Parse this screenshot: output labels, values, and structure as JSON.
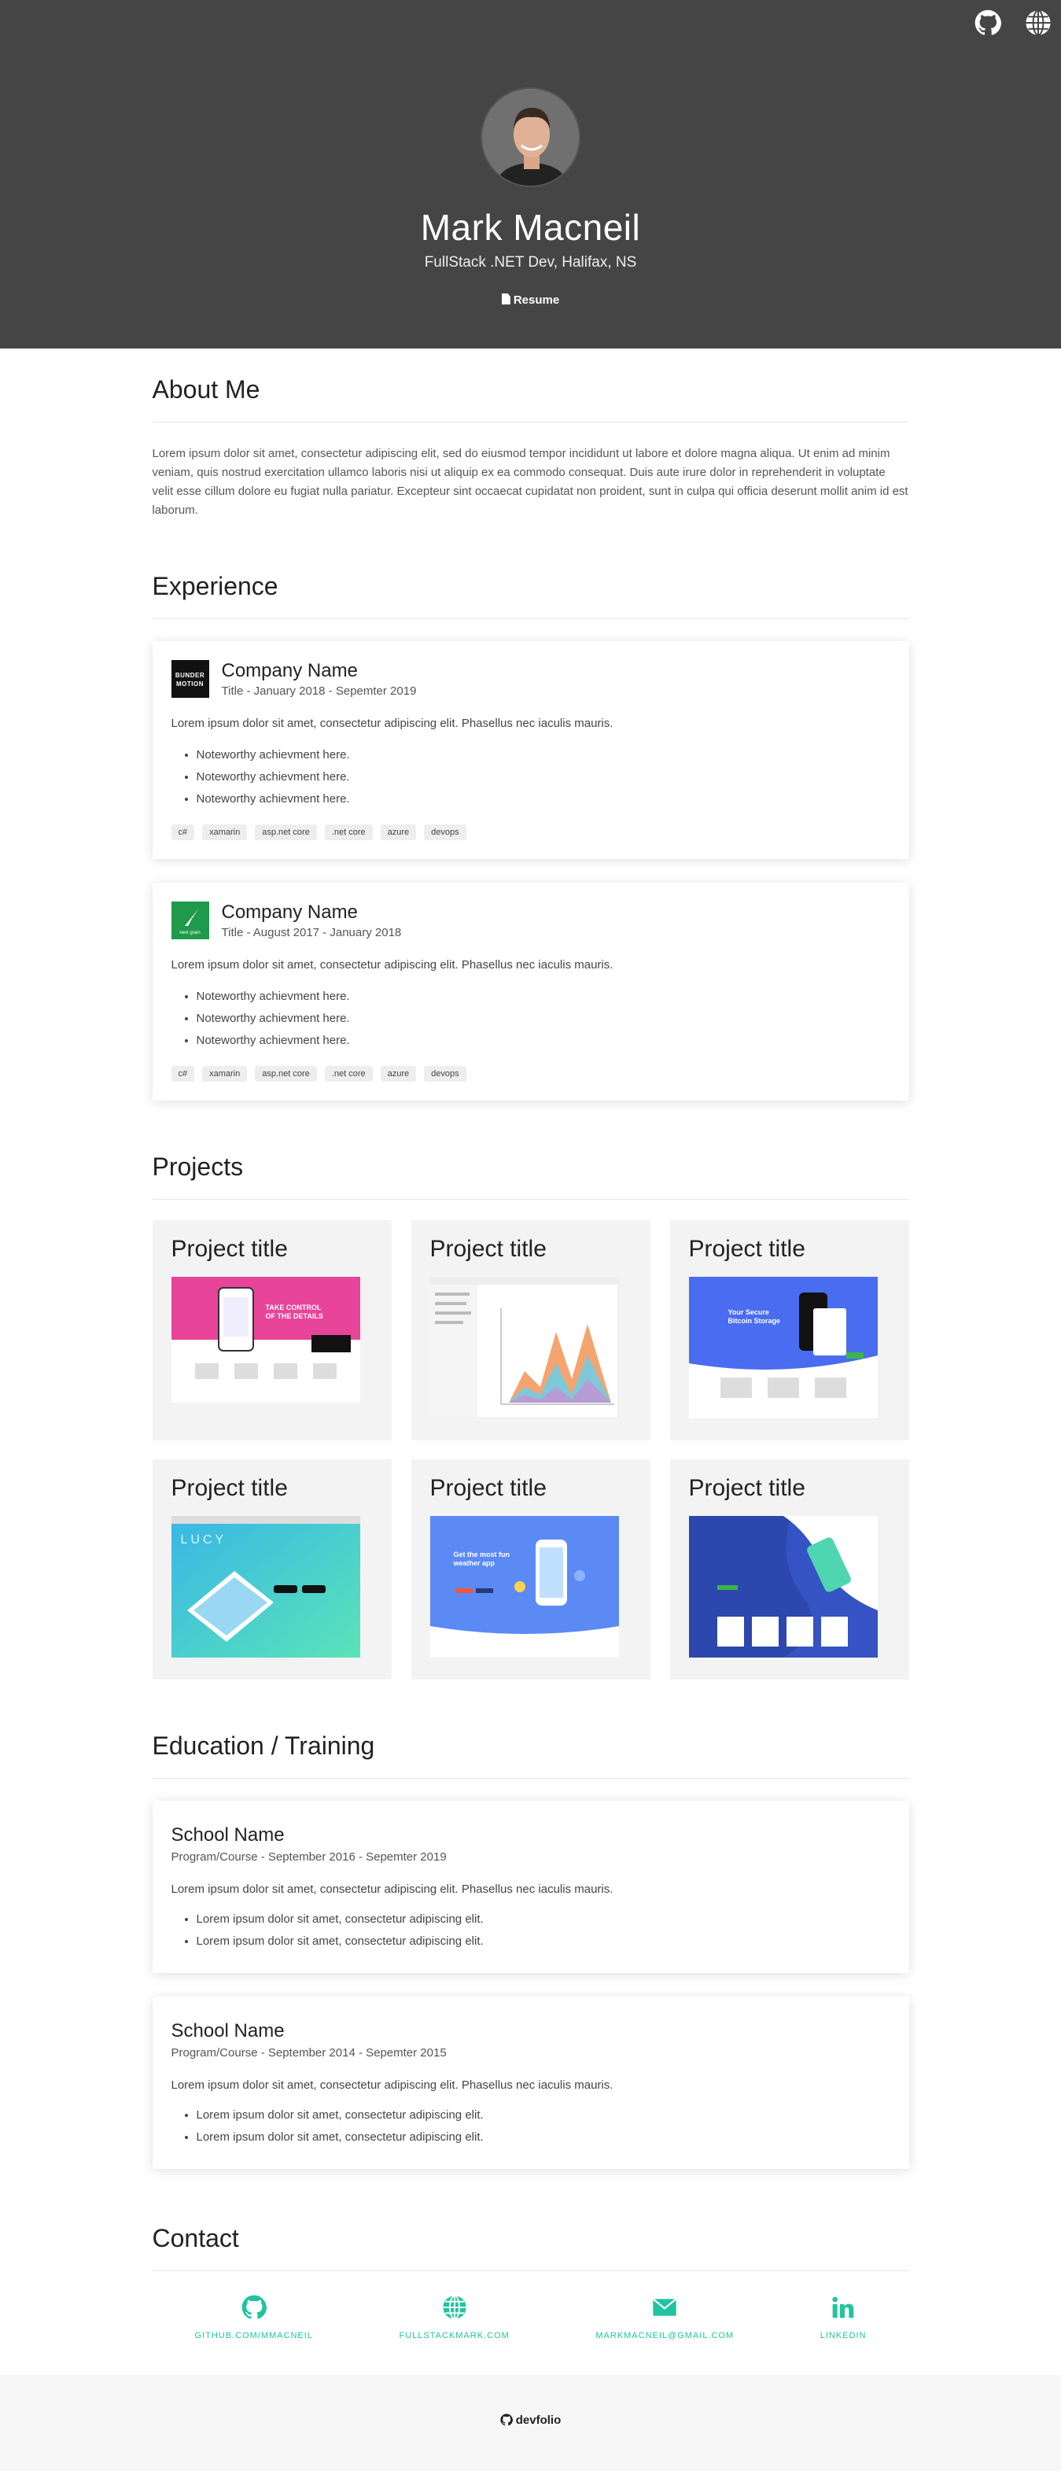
{
  "header": {
    "name": "Mark Macneil",
    "subtitle": "FullStack .NET Dev, Halifax, NS",
    "resume_label": "Resume",
    "icons": [
      "github-icon",
      "globe-icon"
    ]
  },
  "about": {
    "title": "About Me",
    "text": "Lorem ipsum dolor sit amet, consectetur adipiscing elit, sed do eiusmod tempor incididunt ut labore et dolore magna aliqua. Ut enim ad minim veniam, quis nostrud exercitation ullamco laboris nisi ut aliquip ex ea commodo consequat. Duis aute irure dolor in reprehenderit in voluptate velit esse cillum dolore eu fugiat nulla pariatur. Excepteur sint occaecat cupidatat non proident, sunt in culpa qui officia deserunt mollit anim id est laborum."
  },
  "experience": {
    "title": "Experience",
    "items": [
      {
        "company": "Company Name",
        "meta": "Title - January 2018 - Sepemter 2019",
        "logo_text": "BUNDER MOTION",
        "desc": "Lorem ipsum dolor sit amet, consectetur adipiscing elit. Phasellus nec iaculis mauris.",
        "bullets": [
          "Noteworthy achievment here.",
          "Noteworthy achievment here.",
          "Noteworthy achievment here."
        ],
        "tags": [
          "c#",
          "xamarin",
          "asp.net core",
          ".net core",
          "azure",
          "devops"
        ]
      },
      {
        "company": "Company Name",
        "meta": "Title - August 2017 - January 2018",
        "logo_text": "next grain",
        "desc": "Lorem ipsum dolor sit amet, consectetur adipiscing elit. Phasellus nec iaculis mauris.",
        "bullets": [
          "Noteworthy achievment here.",
          "Noteworthy achievment here.",
          "Noteworthy achievment here."
        ],
        "tags": [
          "c#",
          "xamarin",
          "asp.net core",
          ".net core",
          "azure",
          "devops"
        ]
      }
    ]
  },
  "projects": {
    "title": "Projects",
    "items": [
      {
        "title": "Project title",
        "shot_text": "TAKE CONTROL OF THE DETAILS"
      },
      {
        "title": "Project title",
        "shot_text": ""
      },
      {
        "title": "Project title",
        "shot_text": "Your Secure Bitcoin Storage"
      },
      {
        "title": "Project title",
        "shot_text": "LUCY"
      },
      {
        "title": "Project title",
        "shot_text": "Get the most fun weather app"
      },
      {
        "title": "Project title",
        "shot_text": ""
      }
    ]
  },
  "education": {
    "title": "Education / Training",
    "items": [
      {
        "school": "School Name",
        "meta": "Program/Course - September 2016 - Sepemter 2019",
        "desc": "Lorem ipsum dolor sit amet, consectetur adipiscing elit. Phasellus nec iaculis mauris.",
        "bullets": [
          "Lorem ipsum dolor sit amet, consectetur adipiscing elit.",
          "Lorem ipsum dolor sit amet, consectetur adipiscing elit."
        ]
      },
      {
        "school": "School Name",
        "meta": "Program/Course - September 2014 - Sepemter 2015",
        "desc": "Lorem ipsum dolor sit amet, consectetur adipiscing elit. Phasellus nec iaculis mauris.",
        "bullets": [
          "Lorem ipsum dolor sit amet, consectetur adipiscing elit.",
          "Lorem ipsum dolor sit amet, consectetur adipiscing elit."
        ]
      }
    ]
  },
  "contact": {
    "title": "Contact",
    "items": [
      {
        "label": "GITHUB.COM/MMACNEIL",
        "icon": "github-icon"
      },
      {
        "label": "FULLSTACKMARK.COM",
        "icon": "globe-icon"
      },
      {
        "label": "MARKMACNEIL@GMAIL.COM",
        "icon": "email-icon"
      },
      {
        "label": "LINKEDIN",
        "icon": "linkedin-icon"
      }
    ]
  },
  "footer": {
    "label": "devfolio"
  },
  "colors": {
    "header_bg": "#454545",
    "accent": "#20c4a0"
  }
}
